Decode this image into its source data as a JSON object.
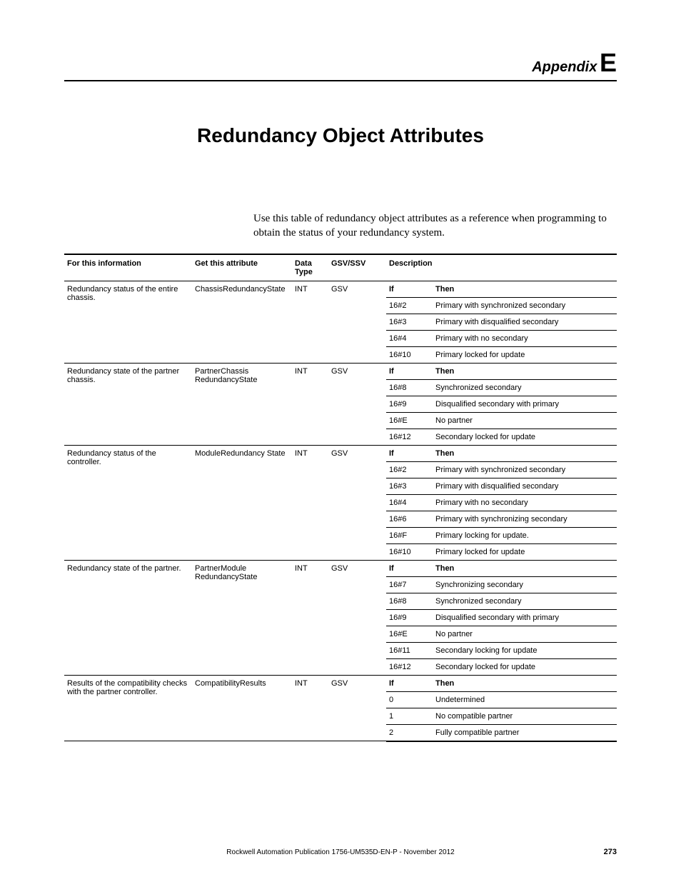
{
  "header": {
    "appendix_word": "Appendix",
    "appendix_letter": "E"
  },
  "title": "Redundancy Object Attributes",
  "intro": "Use this table of redundancy object attributes as a reference when programming to obtain the status of your redundancy system.",
  "columns": {
    "info": "For this information",
    "attr": "Get this attribute",
    "type": "Data Type",
    "gsv": "GSV/SSV",
    "desc": "Description",
    "if": "If",
    "then": "Then"
  },
  "groups": [
    {
      "info": "Redundancy status of the entire chassis.",
      "attr": "ChassisRedundancyState",
      "type": "INT",
      "gsv": "GSV",
      "rows": [
        {
          "if": "16#2",
          "then": "Primary with synchronized secondary"
        },
        {
          "if": "16#3",
          "then": "Primary with disqualified secondary"
        },
        {
          "if": "16#4",
          "then": "Primary with no secondary"
        },
        {
          "if": "16#10",
          "then": "Primary locked for update"
        }
      ]
    },
    {
      "info": "Redundancy state of the partner chassis.",
      "attr": "PartnerChassis RedundancyState",
      "type": "INT",
      "gsv": "GSV",
      "rows": [
        {
          "if": "16#8",
          "then": "Synchronized secondary"
        },
        {
          "if": "16#9",
          "then": "Disqualified secondary with primary"
        },
        {
          "if": "16#E",
          "then": "No partner"
        },
        {
          "if": "16#12",
          "then": "Secondary locked for update"
        }
      ]
    },
    {
      "info": "Redundancy status of the controller.",
      "attr": "ModuleRedundancy State",
      "type": "INT",
      "gsv": "GSV",
      "rows": [
        {
          "if": "16#2",
          "then": "Primary with synchronized secondary"
        },
        {
          "if": "16#3",
          "then": "Primary with disqualified secondary"
        },
        {
          "if": "16#4",
          "then": "Primary with no secondary"
        },
        {
          "if": "16#6",
          "then": "Primary with synchronizing secondary"
        },
        {
          "if": "16#F",
          "then": "Primary locking for update."
        },
        {
          "if": "16#10",
          "then": "Primary locked for update"
        }
      ]
    },
    {
      "info": "Redundancy state of the partner.",
      "attr": "PartnerModule RedundancyState",
      "type": "INT",
      "gsv": "GSV",
      "rows": [
        {
          "if": "16#7",
          "then": "Synchronizing secondary"
        },
        {
          "if": "16#8",
          "then": "Synchronized secondary"
        },
        {
          "if": "16#9",
          "then": "Disqualified secondary with primary"
        },
        {
          "if": "16#E",
          "then": "No partner"
        },
        {
          "if": "16#11",
          "then": "Secondary locking for update"
        },
        {
          "if": "16#12",
          "then": "Secondary locked for update"
        }
      ]
    },
    {
      "info": "Results of the compatibility checks with the partner controller.",
      "attr": "CompatibilityResults",
      "type": "INT",
      "gsv": "GSV",
      "rows": [
        {
          "if": "0",
          "then": "Undetermined"
        },
        {
          "if": "1",
          "then": "No compatible partner"
        },
        {
          "if": "2",
          "then": "Fully compatible partner"
        }
      ]
    }
  ],
  "footer": {
    "line": "Rockwell Automation Publication 1756-UM535D-EN-P - November 2012",
    "page": "273"
  }
}
